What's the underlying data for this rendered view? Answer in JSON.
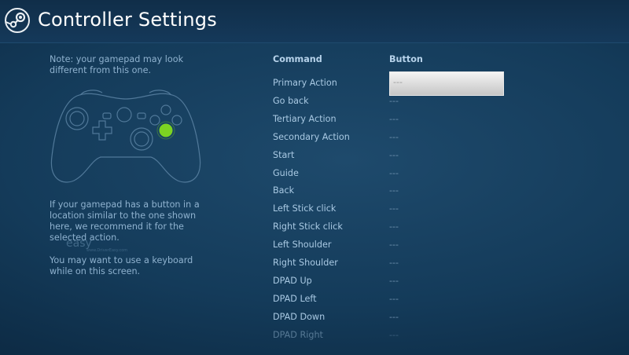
{
  "header": {
    "title": "Controller Settings"
  },
  "left_panel": {
    "note": "Note: your gamepad may look different from this one.",
    "hint": "If your gamepad has a button in a location similar to the one shown here, we recommend it for the selected action.",
    "keyboard_note": "You may want to use a keyboard while on this screen.",
    "watermark": "easy",
    "watermark_sub": "www.DriverEasy.com"
  },
  "table": {
    "col_command": "Command",
    "col_button": "Button",
    "rows": [
      {
        "command": "Primary Action",
        "button": "---",
        "selected": true
      },
      {
        "command": "Go back",
        "button": "---"
      },
      {
        "command": "Tertiary Action",
        "button": "---"
      },
      {
        "command": "Secondary Action",
        "button": "---"
      },
      {
        "command": "Start",
        "button": "---"
      },
      {
        "command": "Guide",
        "button": "---"
      },
      {
        "command": "Back",
        "button": "---"
      },
      {
        "command": "Left Stick click",
        "button": "---"
      },
      {
        "command": "Right Stick click",
        "button": "---"
      },
      {
        "command": "Left Shoulder",
        "button": "---"
      },
      {
        "command": "Right Shoulder",
        "button": "---"
      },
      {
        "command": "DPAD Up",
        "button": "---"
      },
      {
        "command": "DPAD Left",
        "button": "---"
      },
      {
        "command": "DPAD Down",
        "button": "---"
      },
      {
        "command": "DPAD Right",
        "button": "---",
        "faded": true
      }
    ]
  },
  "colors": {
    "highlight_button": "#7cd322"
  }
}
